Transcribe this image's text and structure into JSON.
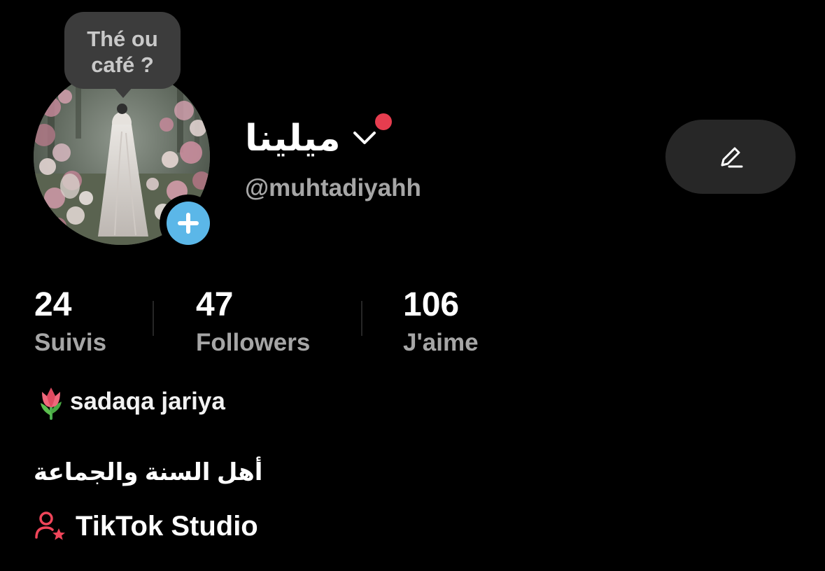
{
  "profile": {
    "note": "Thé ou café ?",
    "display_name": "ميلينا",
    "handle": "@muhtadiyahh",
    "avatar_icon": "profile-photo-veiled-figure-in-flower-garden"
  },
  "stats": {
    "following": {
      "value": "24",
      "label": "Suivis"
    },
    "followers": {
      "value": "47",
      "label": "Followers"
    },
    "likes": {
      "value": "106",
      "label": "J'aime"
    }
  },
  "bio": {
    "line1_emoji": "tulip-icon",
    "line1_text": "sadaqa jariya",
    "line2_text": "أهل السنة والجماعة"
  },
  "studio_link": {
    "icon": "person-star-icon",
    "label": "TikTok Studio"
  },
  "colors": {
    "background": "#000000",
    "secondary_text": "#a6a6a6",
    "add_button": "#5bb7e8",
    "notification_dot": "#e63d4f",
    "accent_red": "#f0455a",
    "edit_button_bg": "#272727",
    "note_bubble_bg": "#3c3c3c"
  }
}
